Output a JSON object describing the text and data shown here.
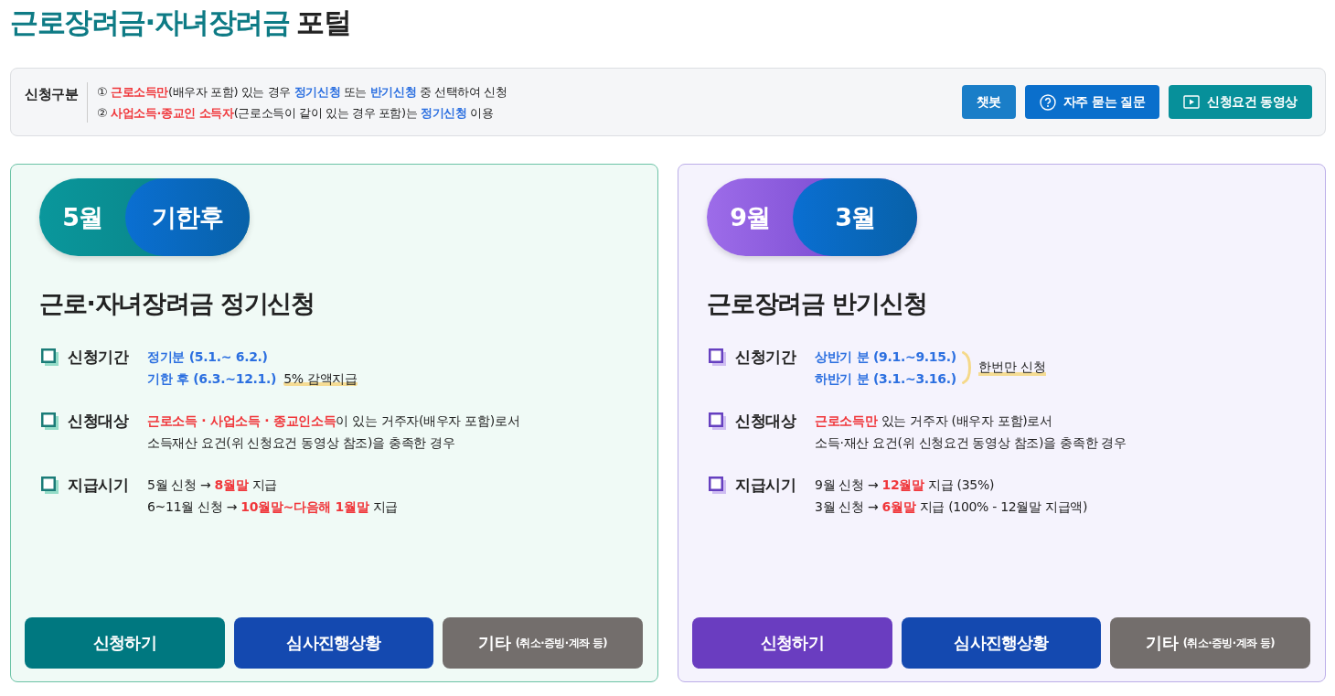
{
  "title": {
    "main": "근로장려금·자녀장려금",
    "suffix": "포털"
  },
  "notice": {
    "label": "신청구분",
    "lines": [
      [
        {
          "text": "① "
        },
        {
          "text": "근로소득만",
          "color": "#f0363a"
        },
        {
          "text": "(배우자 포함) 있는 경우 "
        },
        {
          "text": "정기신청",
          "color": "#2b6fe0"
        },
        {
          "text": " 또는 "
        },
        {
          "text": "반기신청",
          "color": "#2b6fe0"
        },
        {
          "text": " 중 선택하여 신청"
        }
      ],
      [
        {
          "text": "② "
        },
        {
          "text": "사업소득·종교인 소득자",
          "color": "#f0363a"
        },
        {
          "text": "(근로소득이 같이 있는 경우 포함)는 "
        },
        {
          "text": "정기신청",
          "color": "#2b6fe0"
        },
        {
          "text": " 이용"
        }
      ]
    ]
  },
  "actions": [
    {
      "label": "챗봇",
      "kind": "chatbot"
    },
    {
      "label": "자주 묻는 질문",
      "kind": "faq"
    },
    {
      "label": "신청요건 동영상",
      "kind": "video"
    }
  ],
  "cards": [
    {
      "kind": "regular",
      "pill": {
        "start": "5월",
        "end": "기한후"
      },
      "heading": "근로·자녀장려금 정기신청",
      "rows": [
        {
          "label": "신청기간",
          "lines": [
            [
              {
                "text": "정기분 (5.1.~ 6.2.)",
                "color": "#2b6fe0"
              }
            ],
            [
              {
                "text": "기한 후 (6.3.~12.1.)",
                "color": "#2b6fe0",
                "kind": "plain"
              },
              {
                "text": "5% 감액지급",
                "kind": "highlight"
              }
            ]
          ]
        },
        {
          "label": "신청대상",
          "lines": [
            [
              {
                "text": "근로소득 · 사업소득 · 종교인소득",
                "color": "#f0363a"
              },
              {
                "text": "이 있는 거주자(배우자 포함)로서"
              }
            ],
            [
              {
                "text": "소득재산 요건(위 신청요건 동영상 참조)을 충족한 경우"
              }
            ]
          ]
        },
        {
          "label": "지급시기",
          "lines": [
            [
              {
                "text": "5월 신청 → "
              },
              {
                "text": "8월말",
                "color": "#f0363a"
              },
              {
                "text": " 지급"
              }
            ],
            [
              {
                "text": "6~11월 신청 → "
              },
              {
                "text": "10월말~다음해 1월말",
                "color": "#f0363a"
              },
              {
                "text": " 지급"
              }
            ]
          ]
        }
      ],
      "buttons": [
        {
          "label": "신청하기",
          "kind": "apply"
        },
        {
          "label": "심사진행상황",
          "kind": "status"
        },
        {
          "label": "기타",
          "sub": "(취소·증빙·계좌 등)",
          "kind": "other"
        }
      ]
    },
    {
      "kind": "half",
      "pill": {
        "start": "9월",
        "end": "3월"
      },
      "heading": "근로장려금 반기신청",
      "rows": [
        {
          "label": "신청기간",
          "lines": [
            [
              {
                "text": "상반기 분 (9.1.~9.15.)",
                "color": "#2b6fe0"
              }
            ],
            [
              {
                "text": "하반기 분 (3.1.~3.16.)",
                "color": "#2b6fe0"
              }
            ]
          ],
          "note": "한번만 신청"
        },
        {
          "label": "신청대상",
          "lines": [
            [
              {
                "text": "근로소득만",
                "color": "#f0363a"
              },
              {
                "text": " 있는 거주자 (배우자 포함)로서"
              }
            ],
            [
              {
                "text": "소득·재산 요건(위 신청요건 동영상 참조)을 충족한 경우"
              }
            ]
          ]
        },
        {
          "label": "지급시기",
          "lines": [
            [
              {
                "text": "9월 신청 → "
              },
              {
                "text": "12월말",
                "color": "#f0363a"
              },
              {
                "text": " 지급 (35%)"
              }
            ],
            [
              {
                "text": "3월 신청 → "
              },
              {
                "text": "6월말",
                "color": "#f0363a"
              },
              {
                "text": " 지급 (100% - 12월말 지급액)"
              }
            ]
          ]
        }
      ],
      "buttons": [
        {
          "label": "신청하기",
          "kind": "apply"
        },
        {
          "label": "심사진행상황",
          "kind": "status"
        },
        {
          "label": "기타",
          "sub": "(취소·증빙·계좌 등)",
          "kind": "other"
        }
      ]
    }
  ]
}
